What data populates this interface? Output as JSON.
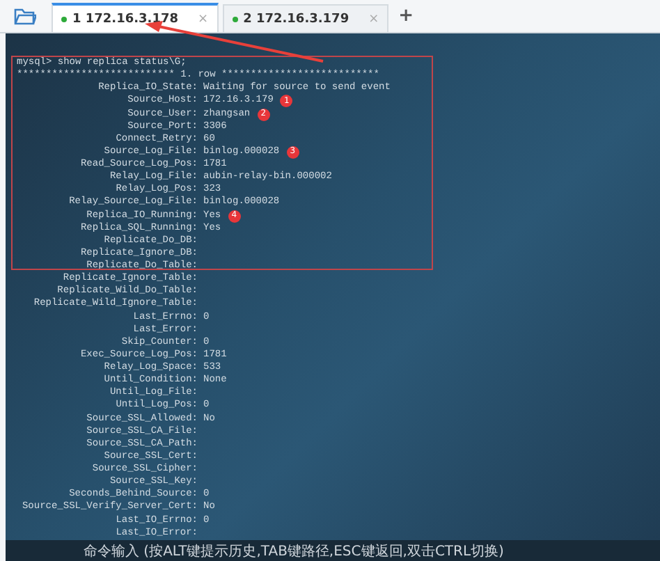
{
  "tabs": [
    {
      "label": "1 172.16.3.178",
      "selected": true,
      "connected": true,
      "close": "×"
    },
    {
      "label": "2 172.16.3.179",
      "selected": false,
      "connected": true,
      "close": "×"
    }
  ],
  "new_tab": "+",
  "terminal": {
    "command": "mysql> show replica status\\G;",
    "row_header": "*************************** 1. row ***************************",
    "fields": [
      {
        "key": "Replica_IO_State:",
        "value": "Waiting for source to send event"
      },
      {
        "key": "Source_Host:",
        "value": "172.16.3.179",
        "badge": "1"
      },
      {
        "key": "Source_User:",
        "value": "zhangsan",
        "badge": "2"
      },
      {
        "key": "Source_Port:",
        "value": "3306"
      },
      {
        "key": "Connect_Retry:",
        "value": "60"
      },
      {
        "key": "Source_Log_File:",
        "value": "binlog.000028",
        "badge": "3"
      },
      {
        "key": "Read_Source_Log_Pos:",
        "value": "1781"
      },
      {
        "key": "Relay_Log_File:",
        "value": "aubin-relay-bin.000002"
      },
      {
        "key": "Relay_Log_Pos:",
        "value": "323"
      },
      {
        "key": "Relay_Source_Log_File:",
        "value": "binlog.000028"
      },
      {
        "key": "Replica_IO_Running:",
        "value": "Yes",
        "badge": "4"
      },
      {
        "key": "Replica_SQL_Running:",
        "value": "Yes"
      },
      {
        "key": "Replicate_Do_DB:"
      },
      {
        "key": "Replicate_Ignore_DB:"
      },
      {
        "key": "Replicate_Do_Table:"
      },
      {
        "key": "Replicate_Ignore_Table:"
      },
      {
        "key": "Replicate_Wild_Do_Table:"
      },
      {
        "key": "Replicate_Wild_Ignore_Table:"
      },
      {
        "key": "Last_Errno:",
        "value": "0"
      },
      {
        "key": "Last_Error:"
      },
      {
        "key": "Skip_Counter:",
        "value": "0"
      },
      {
        "key": "Exec_Source_Log_Pos:",
        "value": "1781"
      },
      {
        "key": "Relay_Log_Space:",
        "value": "533"
      },
      {
        "key": "Until_Condition:",
        "value": "None"
      },
      {
        "key": "Until_Log_File:"
      },
      {
        "key": "Until_Log_Pos:",
        "value": "0"
      },
      {
        "key": "Source_SSL_Allowed:",
        "value": "No"
      },
      {
        "key": "Source_SSL_CA_File:"
      },
      {
        "key": "Source_SSL_CA_Path:"
      },
      {
        "key": "Source_SSL_Cert:"
      },
      {
        "key": "Source_SSL_Cipher:"
      },
      {
        "key": "Source_SSL_Key:"
      },
      {
        "key": "Seconds_Behind_Source:",
        "value": "0"
      },
      {
        "key": "Source_SSL_Verify_Server_Cert:",
        "value": "No"
      },
      {
        "key": "Last_IO_Errno:",
        "value": "0"
      },
      {
        "key": "Last_IO_Error:"
      }
    ]
  },
  "command_bar": {
    "placeholder": "命令输入 (按ALT键提示历史,TAB键路径,ESC键返回,双击CTRL切换)"
  }
}
